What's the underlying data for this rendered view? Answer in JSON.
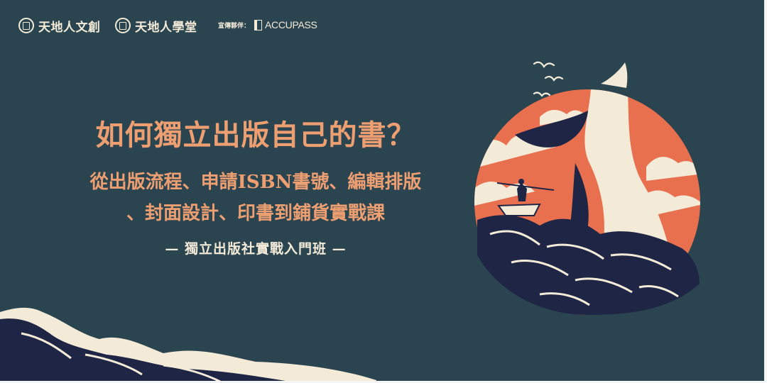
{
  "header": {
    "brand1": "天地人文創",
    "brand2": "天地人學堂",
    "partner_label": "宣傳夥伴：",
    "partner_name": "ACCUPASS"
  },
  "main": {
    "title": "如何獨立出版自己的書？",
    "subtitle_line1": "從出版流程、申請ISBN書號、編輯排版",
    "subtitle_line2": "、封面設計、印書到鋪貨實戰課",
    "tagline": "— 獨立出版社實戰入門班 —"
  },
  "colors": {
    "background": "#2b4550",
    "accent_orange": "#ee9f72",
    "circle_orange": "#e8704f",
    "cream": "#f3ead8",
    "navy": "#1f2645"
  }
}
